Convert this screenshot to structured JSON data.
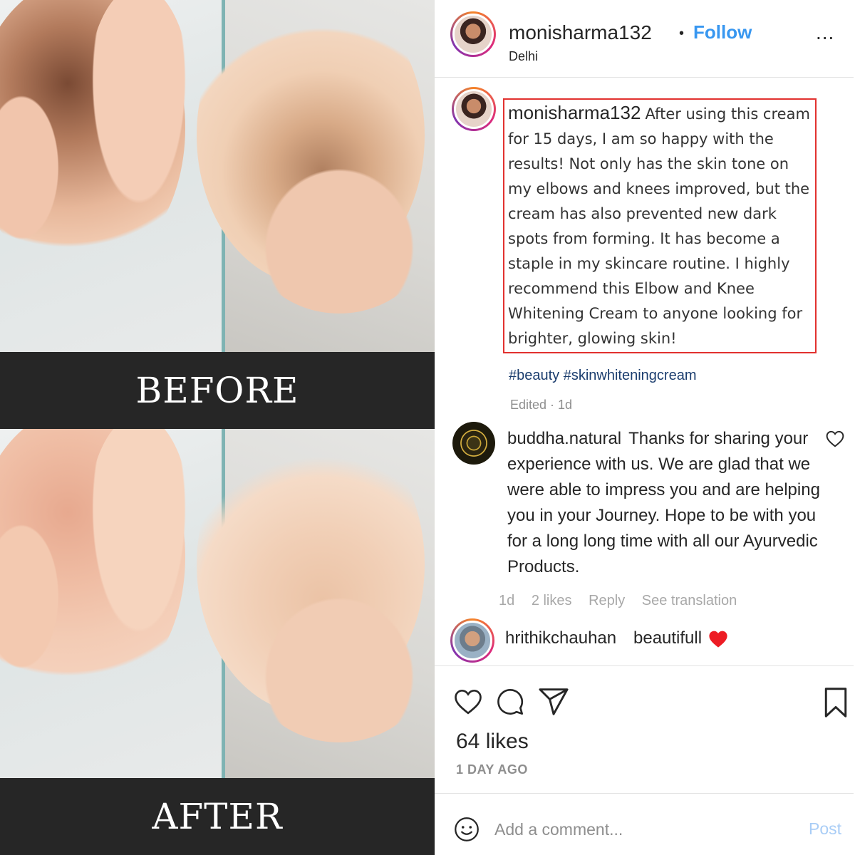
{
  "photo": {
    "before_label": "BEFORE",
    "after_label": "AFTER"
  },
  "header": {
    "username": "monisharma132",
    "location": "Delhi",
    "follow_label": "Follow",
    "dot": "•",
    "more_label": "..."
  },
  "caption": {
    "username": "monisharma132",
    "text": "After using this cream for 15 days, I am so happy with the results! Not only has the skin tone on my elbows and knees improved, but the cream has also prevented new dark spots from forming. It has become a staple in my skincare routine.  I highly recommend this Elbow and Knee Whitening Cream to anyone looking for brighter, glowing skin!",
    "hashtags": [
      "#beauty",
      "#skinwhiteningcream"
    ],
    "meta": "Edited · 1d"
  },
  "comments": [
    {
      "username": "buddha.natural",
      "text": "Thanks for sharing your experience with us. We are glad that we were able to impress you and are helping you in your Journey. Hope to be with you for a long long time with all our Ayurvedic Products.",
      "time": "1d",
      "likes": "2 likes",
      "reply_label": "Reply",
      "translate_label": "See translation"
    },
    {
      "username": "hrithikchauhan",
      "text": "beautifull"
    }
  ],
  "actions": {
    "like_icon": "heart-icon",
    "comment_icon": "comment-icon",
    "share_icon": "share-icon",
    "save_icon": "bookmark-icon"
  },
  "stats": {
    "likes": "64 likes",
    "time_ago": "1 DAY AGO"
  },
  "composer": {
    "placeholder": "Add a comment...",
    "post_label": "Post"
  },
  "colors": {
    "follow_blue": "#3897f0",
    "caption_border": "#e2312f",
    "heart_red": "#ed1c24",
    "post_disabled": "#a9cdf6"
  }
}
